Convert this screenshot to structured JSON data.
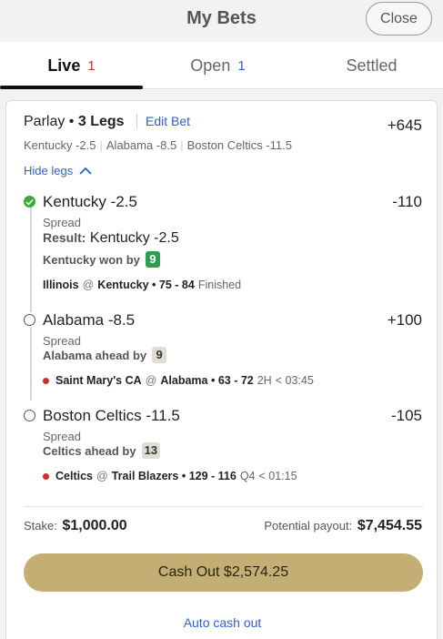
{
  "header": {
    "title": "My Bets",
    "close_label": "Close"
  },
  "tabs": [
    {
      "label": "Live",
      "count": "1"
    },
    {
      "label": "Open",
      "count": "1"
    },
    {
      "label": "Settled",
      "count": ""
    }
  ],
  "bet": {
    "title_prefix": "Parlay",
    "title_legs": "3 Legs",
    "edit_label": "Edit Bet",
    "odds": "+645",
    "summary": [
      "Kentucky -2.5",
      "Alabama -8.5",
      "Boston Celtics -11.5"
    ],
    "hide_legs_label": "Hide legs",
    "legs": [
      {
        "name": "Kentucky -2.5",
        "odds": "-110",
        "type": "Spread",
        "result_label": "Result:",
        "result_value": "Kentucky -2.5",
        "status_text": "Kentucky won by",
        "status_value": "9",
        "away": "Illinois",
        "at": "@",
        "home": "Kentucky",
        "score": "75 - 84",
        "period": "Finished",
        "clock": ""
      },
      {
        "name": "Alabama -8.5",
        "odds": "+100",
        "type": "Spread",
        "status_text": "Alabama ahead by",
        "status_value": "9",
        "away": "Saint Mary's CA",
        "at": "@",
        "home": "Alabama",
        "score": "63 - 72",
        "period": "2H",
        "clock": "< 03:45"
      },
      {
        "name": "Boston Celtics -11.5",
        "odds": "-105",
        "type": "Spread",
        "status_text": "Celtics ahead by",
        "status_value": "13",
        "away": "Celtics",
        "at": "@",
        "home": "Trail Blazers",
        "score": "129 - 116",
        "period": "Q4",
        "clock": "< 01:15"
      }
    ],
    "stake_label": "Stake:",
    "stake_value": "$1,000.00",
    "payout_label": "Potential payout:",
    "payout_value": "$7,454.55",
    "cashout_label": "Cash Out $2,574.25",
    "auto_cashout_label": "Auto cash out"
  },
  "colors": {
    "accent": "#2d5fd6",
    "live": "#d62b2b",
    "won": "#3aa935",
    "cashout": "#c3ae74"
  }
}
